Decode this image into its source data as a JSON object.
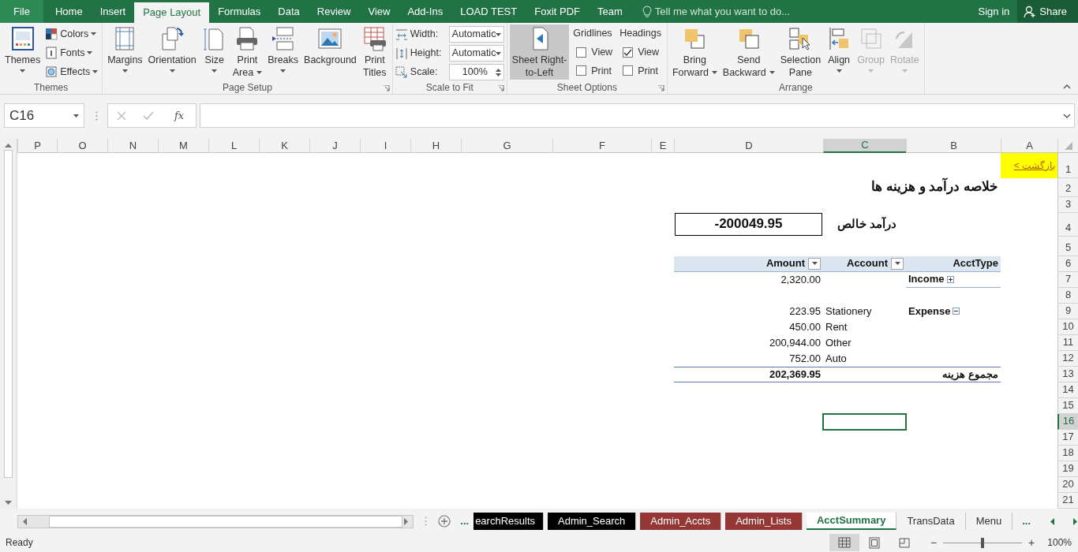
{
  "ribbon_tabs": [
    {
      "label": "File",
      "kind": "file",
      "selected": false
    },
    {
      "label": "Home",
      "kind": "tab",
      "selected": false
    },
    {
      "label": "Insert",
      "kind": "tab",
      "selected": false
    },
    {
      "label": "Page Layout",
      "kind": "tab",
      "selected": true
    },
    {
      "label": "Formulas",
      "kind": "tab",
      "selected": false
    },
    {
      "label": "Data",
      "kind": "tab",
      "selected": false
    },
    {
      "label": "Review",
      "kind": "tab",
      "selected": false
    },
    {
      "label": "View",
      "kind": "tab",
      "selected": false
    },
    {
      "label": "Add-Ins",
      "kind": "tab",
      "selected": false
    },
    {
      "label": "LOAD TEST",
      "kind": "tab",
      "selected": false
    },
    {
      "label": "Foxit PDF",
      "kind": "tab",
      "selected": false
    },
    {
      "label": "Team",
      "kind": "tab",
      "selected": false
    }
  ],
  "tell_me": {
    "placeholder": "Tell me what you want to do..."
  },
  "account": {
    "sign_in": "Sign in",
    "share": "Share"
  },
  "ribbon_groups": [
    {
      "label": "Themes",
      "items": [
        {
          "kind": "large",
          "lines": [
            "Themes"
          ],
          "dropdown": true
        },
        {
          "kind": "stack",
          "items": [
            {
              "kind": "small",
              "label": "Colors",
              "dropdown": true
            },
            {
              "kind": "small",
              "label": "Fonts",
              "dropdown": true
            },
            {
              "kind": "small",
              "label": "Effects",
              "dropdown": true
            }
          ]
        }
      ]
    },
    {
      "label": "Page Setup",
      "launcher": true,
      "items": [
        {
          "kind": "large",
          "lines": [
            "Margins"
          ],
          "dropdown": true
        },
        {
          "kind": "large",
          "lines": [
            "Orientation"
          ],
          "dropdown": true
        },
        {
          "kind": "large",
          "lines": [
            "Size"
          ],
          "dropdown": true
        },
        {
          "kind": "large",
          "lines": [
            "Print",
            "Area"
          ],
          "dropdown": true
        },
        {
          "kind": "large",
          "lines": [
            "Breaks"
          ],
          "dropdown": true
        },
        {
          "kind": "large",
          "lines": [
            "Background"
          ]
        },
        {
          "kind": "large",
          "lines": [
            "Print",
            "Titles"
          ]
        }
      ]
    },
    {
      "label": "Scale to Fit",
      "launcher": true,
      "items": [
        {
          "kind": "stack",
          "items": [
            {
              "kind": "field",
              "label": "Width:",
              "value": "Automatic"
            },
            {
              "kind": "field",
              "label": "Height:",
              "value": "Automatic"
            },
            {
              "kind": "spin",
              "label": "Scale:",
              "value": "100%"
            }
          ]
        }
      ]
    },
    {
      "label": "Sheet Options",
      "launcher": true,
      "items": [
        {
          "kind": "large",
          "lines": [
            "Sheet Right-",
            "to-Left"
          ],
          "pressed": true
        },
        {
          "kind": "checks",
          "heading": "Gridlines",
          "items": [
            {
              "label": "View",
              "checked": false
            },
            {
              "label": "Print",
              "checked": false
            }
          ]
        },
        {
          "kind": "checks",
          "heading": "Headings",
          "items": [
            {
              "label": "View",
              "checked": true
            },
            {
              "label": "Print",
              "checked": false
            }
          ]
        }
      ]
    },
    {
      "label": "Arrange",
      "items": [
        {
          "kind": "large",
          "lines": [
            "Bring",
            "Forward"
          ],
          "dropdown": true,
          "disabled": false
        },
        {
          "kind": "large",
          "lines": [
            "Send",
            "Backward"
          ],
          "dropdown": true,
          "disabled": false
        },
        {
          "kind": "large",
          "lines": [
            "Selection",
            "Pane"
          ],
          "disabled": false
        },
        {
          "kind": "large",
          "lines": [
            "Align"
          ],
          "dropdown": true,
          "disabled": false
        },
        {
          "kind": "large",
          "lines": [
            "Group"
          ],
          "dropdown": true,
          "disabled": true
        },
        {
          "kind": "large",
          "lines": [
            "Rotate"
          ],
          "dropdown": true,
          "disabled": true
        }
      ]
    }
  ],
  "formula_bar": {
    "name_box": "C16",
    "insert_function": "fx"
  },
  "columns": [
    {
      "label": "P",
      "selected": false
    },
    {
      "label": "O",
      "selected": false
    },
    {
      "label": "N",
      "selected": false
    },
    {
      "label": "M",
      "selected": false
    },
    {
      "label": "L",
      "selected": false
    },
    {
      "label": "K",
      "selected": false
    },
    {
      "label": "J",
      "selected": false
    },
    {
      "label": "I",
      "selected": false
    },
    {
      "label": "H",
      "selected": false
    },
    {
      "label": "G",
      "selected": false
    },
    {
      "label": "F",
      "selected": false
    },
    {
      "label": "E",
      "selected": false
    },
    {
      "label": "D",
      "selected": false
    },
    {
      "label": "C",
      "selected": true
    },
    {
      "label": "B",
      "selected": false
    },
    {
      "label": "A",
      "selected": false
    }
  ],
  "rows": [
    {
      "label": "1",
      "selected": false,
      "cells": {
        "A": {
          "kind": "link",
          "text": "بازگشت >"
        }
      }
    },
    {
      "label": "2",
      "selected": false,
      "cells": {
        "B": {
          "kind": "title",
          "text": "خلاصه درآمد و هزینه ها"
        }
      }
    },
    {
      "label": "3",
      "selected": false
    },
    {
      "label": "4",
      "selected": false,
      "cells": {
        "C": {
          "kind": "label",
          "text": "درآمد خالص"
        },
        "D": {
          "kind": "boxed",
          "text": "-200049.95"
        }
      }
    },
    {
      "label": "5",
      "selected": false
    },
    {
      "label": "6",
      "selected": false,
      "cells": {
        "B": {
          "kind": "header",
          "text": "AcctType"
        },
        "C": {
          "kind": "header",
          "text": "Account",
          "filter": true
        },
        "D": {
          "kind": "header",
          "text": "Amount",
          "filter": true
        }
      }
    },
    {
      "label": "7",
      "selected": false,
      "cells": {
        "B": {
          "kind": "group",
          "text": "Income",
          "expanded": false
        },
        "D": {
          "kind": "number",
          "text": "2,320.00"
        }
      }
    },
    {
      "label": "8",
      "selected": false
    },
    {
      "label": "9",
      "selected": false,
      "cells": {
        "B": {
          "kind": "group",
          "text": "Expense",
          "expanded": true
        },
        "C": {
          "kind": "text",
          "text": "Stationery"
        },
        "D": {
          "kind": "number",
          "text": "223.95"
        }
      }
    },
    {
      "label": "10",
      "selected": false,
      "cells": {
        "C": {
          "kind": "text",
          "text": "Rent"
        },
        "D": {
          "kind": "number",
          "text": "450.00"
        }
      }
    },
    {
      "label": "11",
      "selected": false,
      "cells": {
        "C": {
          "kind": "text",
          "text": "Other"
        },
        "D": {
          "kind": "number",
          "text": "200,944.00"
        }
      }
    },
    {
      "label": "12",
      "selected": false,
      "cells": {
        "C": {
          "kind": "text",
          "text": "Auto"
        },
        "D": {
          "kind": "number",
          "text": "752.00"
        }
      }
    },
    {
      "label": "13",
      "selected": false,
      "cells": {
        "B": {
          "kind": "total-label",
          "text": "مجموع هزینه"
        },
        "D": {
          "kind": "total-number",
          "text": "202,369.95"
        }
      }
    },
    {
      "label": "14",
      "selected": false
    },
    {
      "label": "15",
      "selected": false
    },
    {
      "label": "16",
      "selected": true
    },
    {
      "label": "17",
      "selected": false
    },
    {
      "label": "18",
      "selected": false
    },
    {
      "label": "19",
      "selected": false
    },
    {
      "label": "20",
      "selected": false
    },
    {
      "label": "21",
      "selected": false
    }
  ],
  "sheet_tabs": [
    {
      "label": "earchResults",
      "color": "#000000",
      "selected": false
    },
    {
      "label": "Admin_Search",
      "color": "#000000",
      "selected": false
    },
    {
      "label": "Admin_Accts",
      "color": "#953735",
      "selected": false
    },
    {
      "label": "Admin_Lists",
      "color": "#953735",
      "selected": false
    },
    {
      "label": "AcctSummary",
      "selected": true
    },
    {
      "label": "TransData",
      "selected": false
    },
    {
      "label": "Menu",
      "selected": false
    }
  ],
  "tabs_more_left": "...",
  "tabs_more_right": "...",
  "status_bar": {
    "text": "Ready",
    "views": [
      {
        "selected": true
      },
      {
        "selected": false
      },
      {
        "selected": false
      }
    ],
    "zoom_out": "−",
    "zoom_in": "+",
    "zoom": {
      "level": 0.5
    },
    "zoom_reading": "100%"
  }
}
